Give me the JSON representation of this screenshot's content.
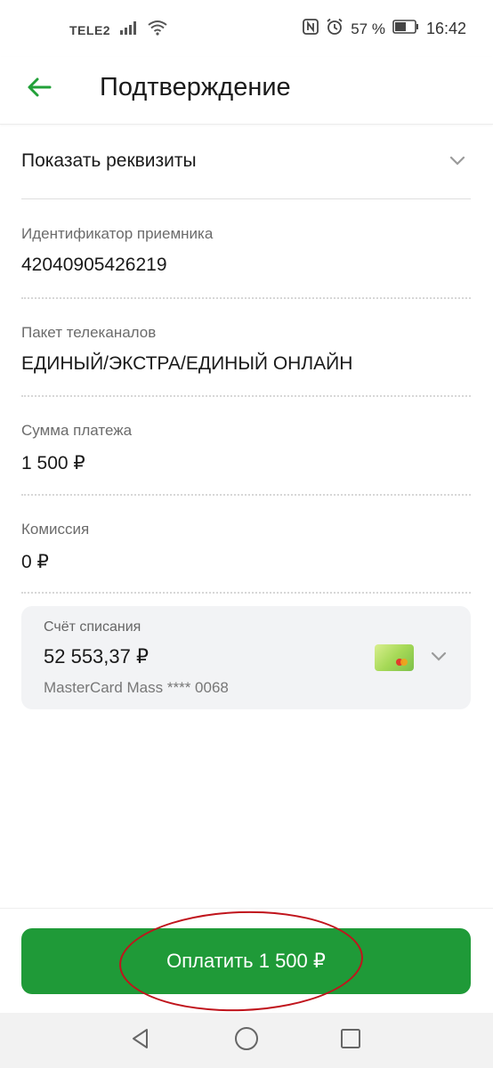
{
  "status_bar": {
    "carrier": "TELE2",
    "battery_percent": "57 %",
    "time": "16:42",
    "icons": [
      "signal-icon",
      "wifi-icon",
      "nfc-icon",
      "alarm-icon",
      "battery-icon"
    ]
  },
  "header": {
    "title": "Подтверждение",
    "back_icon": "back-arrow-icon",
    "accent_color": "#21a038"
  },
  "details_toggle": {
    "label": "Показать реквизиты",
    "icon": "chevron-down-icon"
  },
  "fields": [
    {
      "label": "Идентификатор приемника",
      "value": "42040905426219"
    },
    {
      "label": "Пакет телеканалов",
      "value": "ЕДИНЫЙ/ЭКСТРА/ЕДИНЫЙ ОНЛАЙН"
    },
    {
      "label": "Сумма платежа",
      "value": "1 500 ₽"
    },
    {
      "label": "Комиссия",
      "value": "0 ₽"
    }
  ],
  "account": {
    "label": "Счёт списания",
    "balance": "52 553,37 ₽",
    "card_name": "MasterCard Mass **** 0068",
    "card_icon": "mastercard-card-icon",
    "chevron_icon": "chevron-down-icon"
  },
  "pay_button": {
    "label": "Оплатить 1 500 ₽",
    "color": "#1f9a38",
    "highlight_color": "#c0141c"
  },
  "nav_bar": {
    "icons": [
      "nav-back-icon",
      "nav-home-icon",
      "nav-recents-icon"
    ]
  }
}
